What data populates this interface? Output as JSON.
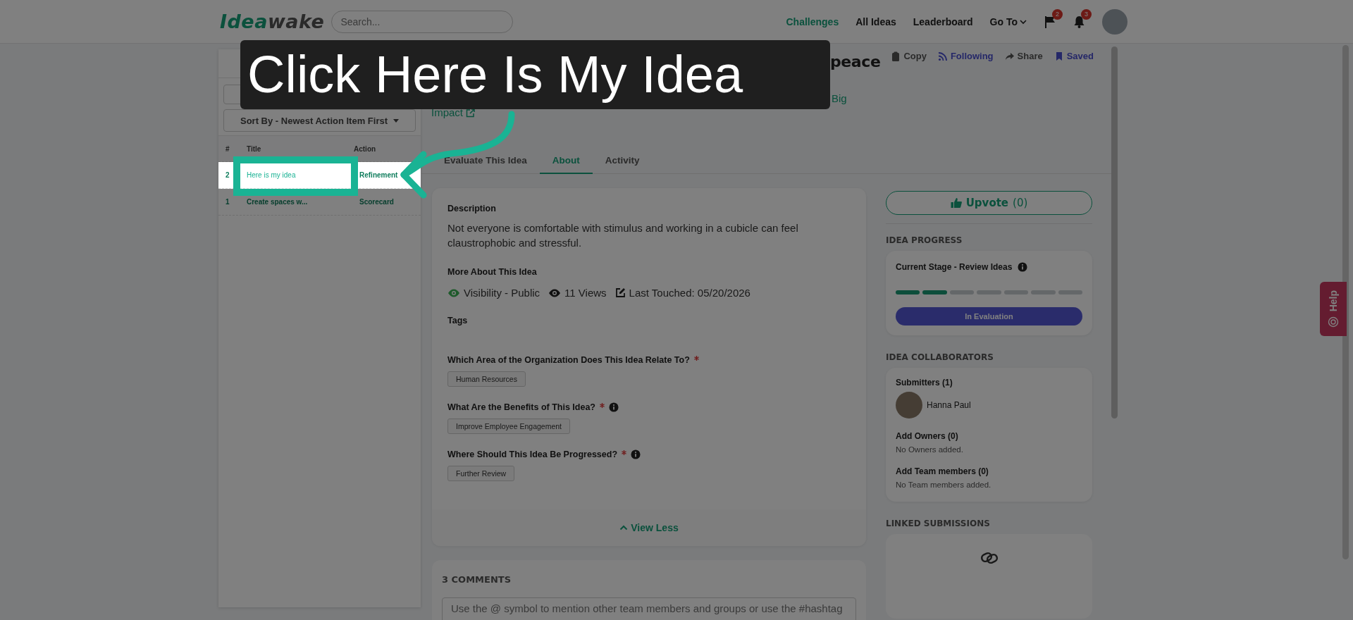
{
  "header": {
    "logo_parts": [
      "Idea",
      "wake"
    ],
    "search": {
      "placeholder": "Search..."
    },
    "nav": [
      {
        "label": "Challenges",
        "selected": true
      },
      {
        "label": "All Ideas",
        "selected": false
      },
      {
        "label": "Leaderboard",
        "selected": false
      }
    ],
    "goto": "Go To",
    "flag_badge": "2",
    "bell_badge": "3"
  },
  "sidebar": {
    "sort": "Sort By - Newest Action Item First",
    "columns": [
      "#",
      "Title",
      "Action"
    ],
    "rows": [
      {
        "number": "2",
        "title": "Here is my idea",
        "action": "Refinement",
        "highlighted": true
      },
      {
        "number": "1",
        "title": "Create spaces w...",
        "action": "Scorecard",
        "highlighted": false
      }
    ]
  },
  "idea": {
    "title": "peace",
    "actions": [
      {
        "kind": "copy",
        "label": "Copy"
      },
      {
        "kind": "following",
        "label": "Following"
      },
      {
        "kind": "share",
        "label": "Share"
      },
      {
        "kind": "saved",
        "label": "Saved"
      }
    ],
    "challenge_lines": [
      "Big",
      "Impact"
    ],
    "tabs": [
      {
        "label": "Evaluate This Idea",
        "selected": false
      },
      {
        "label": "About",
        "selected": true
      },
      {
        "label": "Activity",
        "selected": false
      }
    ]
  },
  "about": {
    "description_label": "Description",
    "description": "Not everyone is comfortable with stimulus and working in a cubicle can feel claustrophobic and stressful.",
    "more_label": "More About This Idea",
    "meta": [
      {
        "kind": "visibility",
        "text": "Visibility - Public"
      },
      {
        "kind": "views",
        "text": "11 Views"
      },
      {
        "kind": "touched",
        "text": "Last Touched: 05/20/2026"
      }
    ],
    "tags_label": "Tags",
    "questions": [
      {
        "question": "Which Area of the Organization Does This Idea Relate To?",
        "required": true,
        "info": false,
        "answer": "Human Resources"
      },
      {
        "question": "What Are the Benefits of This Idea?",
        "required": true,
        "info": true,
        "answer": "Improve Employee Engagement"
      },
      {
        "question": "Where Should This Idea Be Progressed?",
        "required": true,
        "info": true,
        "answer": "Further Review"
      }
    ],
    "view_less": "View Less"
  },
  "comments": {
    "title": "3 COMMENTS",
    "placeholder": "Use the @ symbol to mention other team members and groups or use the #hashtag"
  },
  "side": {
    "upvote": {
      "label": "Upvote",
      "count": "(0)"
    },
    "progress": {
      "heading": "IDEA PROGRESS",
      "stage": "Current Stage - Review Ideas",
      "segments": [
        {
          "done": true
        },
        {
          "done": true
        },
        {
          "done": false
        },
        {
          "done": false
        },
        {
          "done": false
        },
        {
          "done": false
        },
        {
          "done": false
        }
      ],
      "status": "In Evaluation"
    },
    "collaborators": {
      "heading": "IDEA COLLABORATORS",
      "submitters_title": "Submitters (1)",
      "submitters": [
        "Hanna Paul"
      ],
      "owners_title": "Add Owners (0)",
      "owners_empty": "No Owners added.",
      "team_title": "Add Team members (0)",
      "team_empty": "No Team members added."
    },
    "linked": {
      "heading": "LINKED SUBMISSIONS"
    }
  },
  "help": {
    "label": "Help"
  },
  "tour": {
    "tooltip": "Click Here Is My Idea"
  }
}
